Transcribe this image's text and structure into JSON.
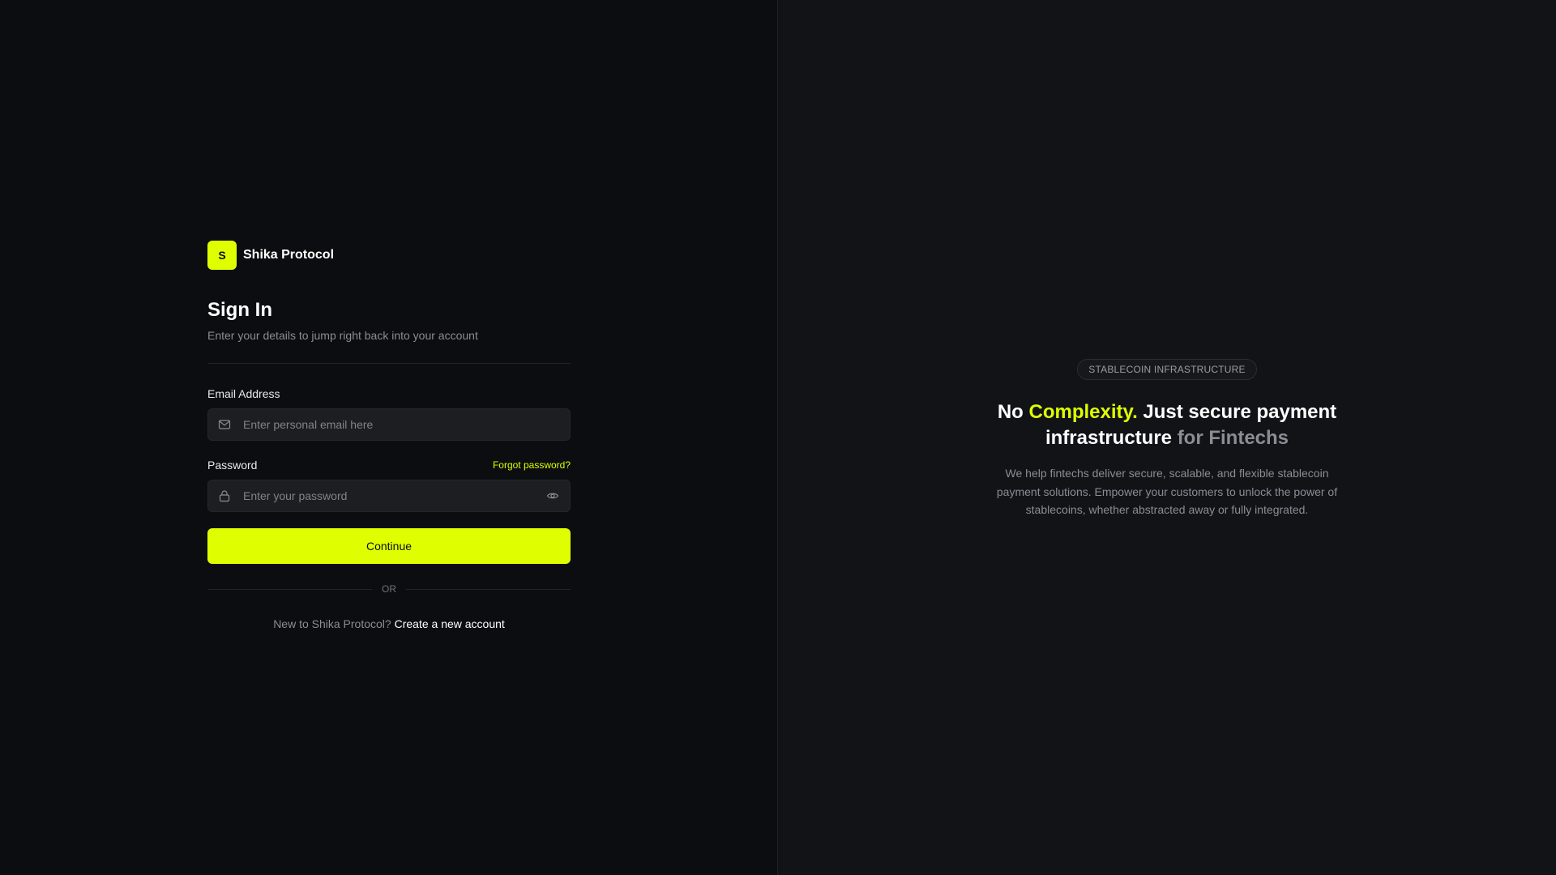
{
  "brand": {
    "logo_letter": "S",
    "name": "Shika Protocol",
    "accent_color": "#dfff00"
  },
  "signin": {
    "title": "Sign In",
    "subtitle": "Enter your details to jump right back into your account"
  },
  "email": {
    "label": "Email Address",
    "placeholder": "Enter personal email here",
    "value": "",
    "icon": "mail-icon"
  },
  "password": {
    "label": "Password",
    "forgot_label": "Forgot password?",
    "placeholder": "Enter your password",
    "value": "",
    "icon": "lock-icon",
    "toggle_icon": "eye-icon"
  },
  "continue_label": "Continue",
  "or_label": "OR",
  "signup": {
    "prefix": "New to Shika Protocol?",
    "link": "Create a new account"
  },
  "hero": {
    "badge": "STABLECOIN INFRASTRUCTURE",
    "heading_part1": "No",
    "heading_accent": "Complexity.",
    "heading_part2": "Just secure payment infrastructure",
    "heading_muted": "for Fintechs",
    "description": "We help fintechs deliver secure, scalable, and flexible stablecoin payment solutions. Empower your customers to unlock the power of stablecoins, whether abstracted away or fully integrated."
  },
  "colors": {
    "background_left": "#0c0d10",
    "background_right": "#111317",
    "input_bg": "#1c1e22",
    "muted_text": "#8a8d95"
  }
}
